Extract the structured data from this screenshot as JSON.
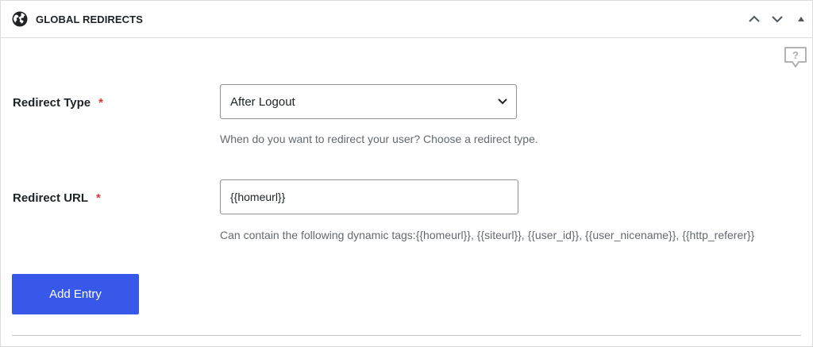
{
  "panel": {
    "title": "GLOBAL REDIRECTS",
    "header_icon": "globe-icon",
    "controls": [
      "chevron-up-icon",
      "chevron-down-icon",
      "caret-up-icon"
    ],
    "help_icon": "help-question-icon",
    "help_icon_glyph": "?"
  },
  "form": {
    "redirect_type": {
      "label": "Redirect Type",
      "required_mark": "*",
      "selected_value": "After Logout",
      "help": "When do you want to redirect your user? Choose a redirect type."
    },
    "redirect_url": {
      "label": "Redirect URL",
      "required_mark": "*",
      "value": "{{homeurl}}",
      "help": "Can contain the following dynamic tags:{{homeurl}}, {{siteurl}}, {{user_id}}, {{user_nicename}}, {{http_referer}}"
    },
    "add_button_label": "Add Entry"
  },
  "colors": {
    "accent": "#3858e9",
    "required": "#d63638",
    "help_text": "#646970",
    "border": "#dcdcde"
  }
}
